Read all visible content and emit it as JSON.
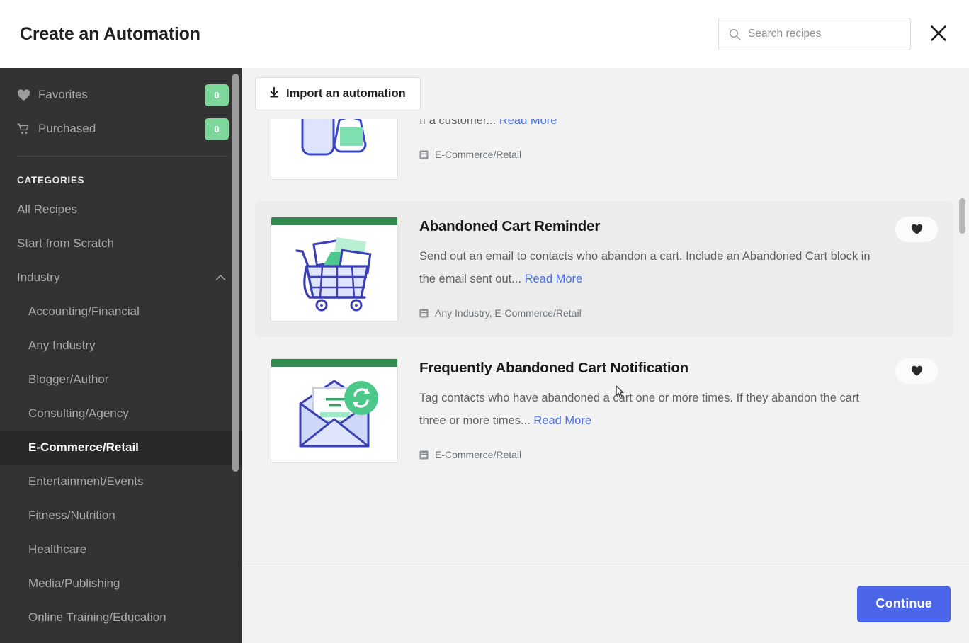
{
  "header": {
    "title": "Create an Automation",
    "search": {
      "placeholder": "Search recipes",
      "value": "",
      "icon": "search-icon"
    },
    "close_icon": "close-icon"
  },
  "sidebar": {
    "quick_links": [
      {
        "label": "Favorites",
        "icon": "heart-icon",
        "badge": "0"
      },
      {
        "label": "Purchased",
        "icon": "cart-icon",
        "badge": "0"
      }
    ],
    "categories_heading": "CATEGORIES",
    "items": [
      {
        "label": "All Recipes",
        "type": "item",
        "active": false
      },
      {
        "label": "Start from Scratch",
        "type": "item",
        "active": false
      },
      {
        "label": "Industry",
        "type": "group",
        "active": false,
        "icon": "chevron-up-icon"
      },
      {
        "label": "Accounting/Financial",
        "type": "sub",
        "active": false
      },
      {
        "label": "Any Industry",
        "type": "sub",
        "active": false
      },
      {
        "label": "Blogger/Author",
        "type": "sub",
        "active": false
      },
      {
        "label": "Consulting/Agency",
        "type": "sub",
        "active": false
      },
      {
        "label": "E-Commerce/Retail",
        "type": "sub",
        "active": true
      },
      {
        "label": "Entertainment/Events",
        "type": "sub",
        "active": false
      },
      {
        "label": "Fitness/Nutrition",
        "type": "sub",
        "active": false
      },
      {
        "label": "Healthcare",
        "type": "sub",
        "active": false
      },
      {
        "label": "Media/Publishing",
        "type": "sub",
        "active": false
      },
      {
        "label": "Online Training/Education",
        "type": "sub",
        "active": false
      }
    ]
  },
  "toolbar": {
    "import_label": "Import an automation",
    "import_icon": "download-arrow-icon"
  },
  "recipes": [
    {
      "title": "",
      "description": "Make sure your contacts have everything they need to complete their product experience. If a customer...",
      "read_more": "Read More",
      "tags": "E-Commerce/Retail",
      "tag_icon": "tag-icon",
      "thumb_art": "product-bottles-illustration",
      "highlight": false,
      "favorited": false
    },
    {
      "title": "Abandoned Cart Reminder",
      "description": "Send out an email to contacts who abandon a cart. Include an Abandoned Cart block in the email sent out...",
      "read_more": "Read More",
      "tags": "Any Industry, E-Commerce/Retail",
      "tag_icon": "tag-icon",
      "thumb_art": "shopping-cart-illustration",
      "highlight": true,
      "favorited": false
    },
    {
      "title": "Frequently Abandoned Cart Notification",
      "description": "Tag contacts who have abandoned a cart one or more times. If they abandon the cart three or more times...",
      "read_more": "Read More",
      "tags": "E-Commerce/Retail",
      "tag_icon": "tag-icon",
      "thumb_art": "envelope-sync-illustration",
      "highlight": false,
      "favorited": false
    }
  ],
  "footer": {
    "continue_label": "Continue"
  },
  "colors": {
    "sidebar_bg": "#333333",
    "sidebar_active": "#292929",
    "badge_green": "#7ed79a",
    "thumb_bar_green": "#2f8b4e",
    "link_blue": "#4a6fe0",
    "primary_button": "#4b65e8",
    "content_bg": "#f2f2f2"
  }
}
